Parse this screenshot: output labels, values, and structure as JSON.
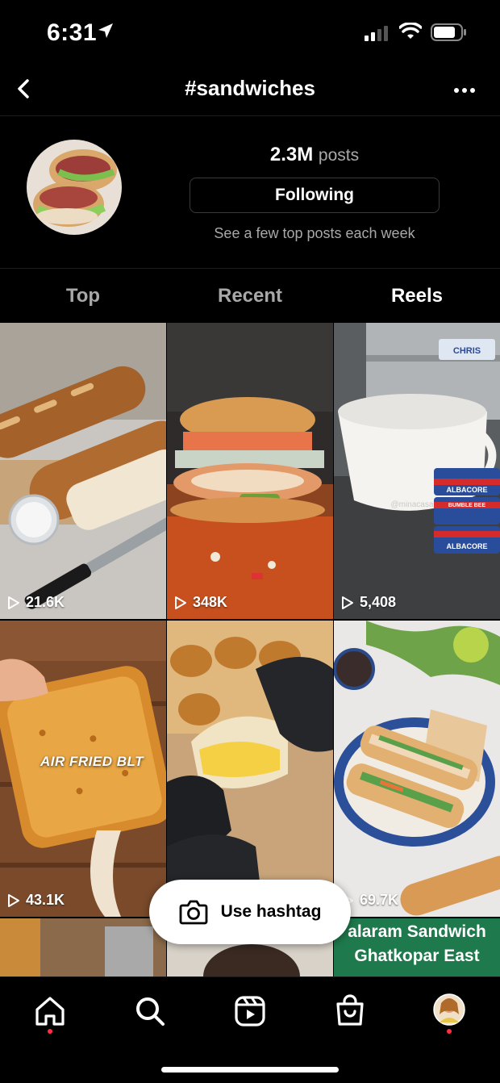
{
  "status_bar": {
    "time": "6:31"
  },
  "nav": {
    "title": "#sandwiches"
  },
  "header": {
    "post_count": "2.3M",
    "post_label": "posts",
    "follow_label": "Following",
    "subtext": "See a few top posts each week"
  },
  "tabs": [
    {
      "label": "Top",
      "active": false
    },
    {
      "label": "Recent",
      "active": false
    },
    {
      "label": "Reels",
      "active": true
    }
  ],
  "grid": {
    "items": [
      {
        "views": "21.6K",
        "subject": "baguettes"
      },
      {
        "views": "348K",
        "subject": "fried chicken sandwich"
      },
      {
        "views": "5,408",
        "subject": "tuna cans and bowl",
        "watermark": "@minacasarica",
        "can_brand": "BUMBLE BEE",
        "can_type": "ALBACORE",
        "sticker": "CHRIS"
      },
      {
        "views": "43.1K",
        "subject": "grilled toast",
        "overlay": "AIR FRIED BLT"
      },
      {
        "views": "",
        "subject": "egg slider"
      },
      {
        "views": "69.7K",
        "subject": "banh mi"
      }
    ],
    "partial_caption": [
      "alaram Sandwich",
      "Ghatkopar East"
    ]
  },
  "use_hashtag": {
    "label": "Use hashtag",
    "icon": "camera-icon"
  },
  "bottom_nav": {
    "items": [
      "home-icon",
      "search-icon",
      "reels-icon",
      "shop-icon",
      "profile-avatar"
    ],
    "accent": "#ff3040"
  }
}
